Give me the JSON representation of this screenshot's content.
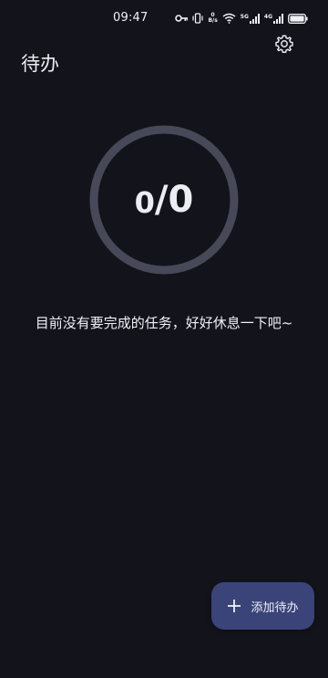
{
  "status_bar": {
    "time": "09:47",
    "net_speed_top": "0",
    "net_speed_bottom": "B/s",
    "signal_1_label": "5G",
    "signal_2_label": "4G"
  },
  "header": {
    "title": "待办"
  },
  "progress": {
    "done": "0",
    "separator": "/",
    "total": "0"
  },
  "empty_state": {
    "message": "目前没有要完成的任务，好好休息一下吧~"
  },
  "fab": {
    "label": "添加待办"
  },
  "colors": {
    "background": "#13141b",
    "ring": "#474858",
    "fab": "#3a4478",
    "text": "#ececf2"
  }
}
